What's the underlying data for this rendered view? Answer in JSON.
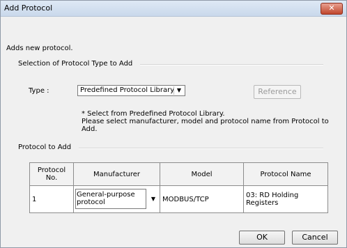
{
  "window": {
    "title": "Add Protocol",
    "close_label": "✕"
  },
  "intro": "Adds new protocol.",
  "selection_group": {
    "label": "Selection of Protocol Type to Add",
    "type_label": "Type :",
    "type_value": "Predefined Protocol Library",
    "reference_button": "Reference",
    "note_line1": "* Select from Predefined Protocol Library.",
    "note_line2": "Please select manufacturer, model and protocol name from Protocol to",
    "note_line3": "Add."
  },
  "protocol_group": {
    "label": "Protocol to Add",
    "columns": {
      "no_line1": "Protocol",
      "no_line2": "No.",
      "manufacturer": "Manufacturer",
      "model": "Model",
      "protocol_name": "Protocol Name"
    },
    "rows": [
      {
        "no": "1",
        "manufacturer_line1": "General-purpose",
        "manufacturer_line2": "protocol",
        "model": "MODBUS/TCP",
        "protocol_name_line1": "03: RD Holding",
        "protocol_name_line2": "Registers"
      }
    ]
  },
  "buttons": {
    "ok": "OK",
    "cancel": "Cancel"
  }
}
